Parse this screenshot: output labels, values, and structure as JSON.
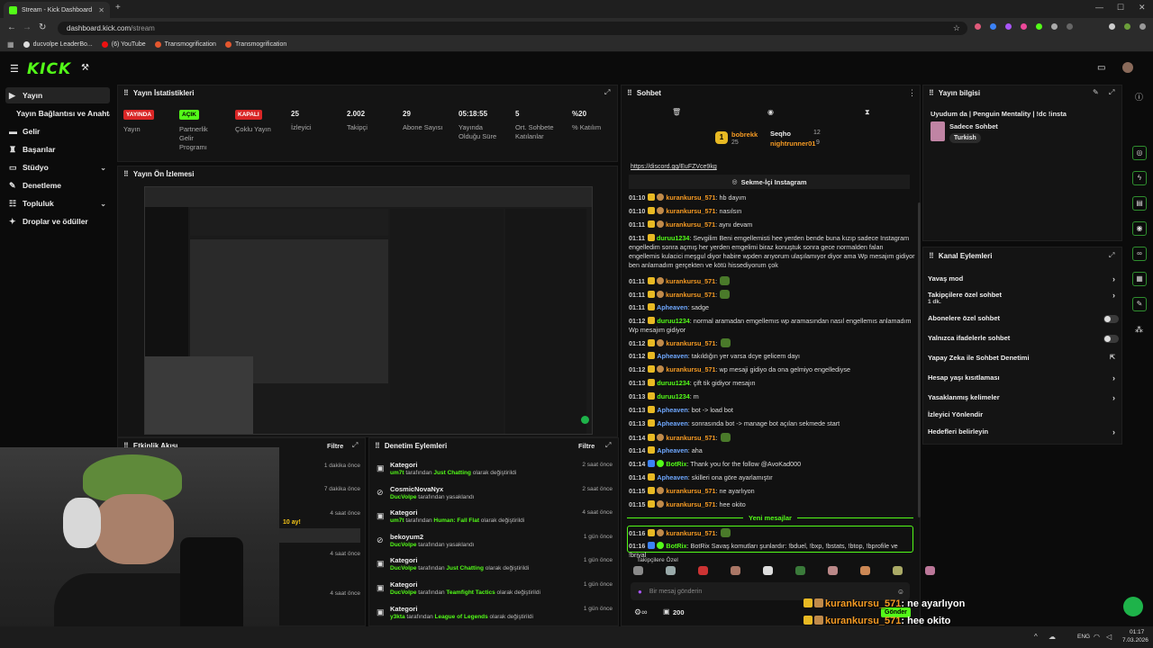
{
  "browser": {
    "tab_title": "Stream - Kick Dashboard",
    "url_host": "dashboard.kick.com",
    "url_path": "/stream",
    "bookmarks": [
      "ducvolpe LeaderBo...",
      "(6) YouTube",
      "Transmogrification",
      "Transmogrification"
    ]
  },
  "brand": {
    "logo": "KICK",
    "accent": "#53fc18"
  },
  "sidebar": {
    "items": [
      {
        "label": "Yayın",
        "icon": "video-icon"
      },
      {
        "label": "Yayın Bağlantısı ve Anahtarı",
        "icon": ""
      },
      {
        "label": "Gelir",
        "icon": "money-icon"
      },
      {
        "label": "Başarılar",
        "icon": "trophy-icon"
      },
      {
        "label": "Stüdyo",
        "icon": "studio-icon"
      },
      {
        "label": "Denetleme",
        "icon": "wrench-icon"
      },
      {
        "label": "Topluluk",
        "icon": "community-icon"
      },
      {
        "label": "Droplar ve ödüller",
        "icon": "gift-icon"
      }
    ]
  },
  "stats": {
    "title": "Yayın İstatistikleri",
    "items": [
      {
        "badge": "YAYINDA",
        "label": "Yayın"
      },
      {
        "badge": "AÇIK",
        "label": "Partnerlik Gelir Programı"
      },
      {
        "badge": "KAPALI",
        "label": "Çoklu Yayın"
      },
      {
        "value": "25",
        "label": "İzleyici"
      },
      {
        "value": "2.002",
        "label": "Takipçi"
      },
      {
        "value": "29",
        "label": "Abone Sayısı"
      },
      {
        "value": "05:18:55",
        "label": "Yayında Olduğu Süre"
      },
      {
        "value": "5",
        "label": "Ort. Sohbete Katılanlar"
      },
      {
        "value": "%20",
        "label": "% Katılım"
      }
    ]
  },
  "preview": {
    "title": "Yayın Ön İzlemesi"
  },
  "activity": {
    "title": "Etkinlik Akışı",
    "filter": "Filtre",
    "times": [
      "1 dakika önce",
      "7 dakika önce",
      "4 saat önce",
      "4 saat önce",
      "4 saat önce"
    ],
    "snippet": "10 ay!"
  },
  "mod": {
    "title": "Denetim Eylemleri",
    "filter": "Filtre",
    "rows": [
      {
        "title": "Kategori",
        "user": "um7t",
        "mid": " tarafından ",
        "target": "Just Chatting",
        "tail": " olarak değiştirildi",
        "time": "2 saat önce"
      },
      {
        "title": "CosmicNovaNyx",
        "user": "DucVolpe",
        "mid": " tarafından yasaklandı",
        "target": "",
        "tail": "",
        "time": "2 saat önce"
      },
      {
        "title": "Kategori",
        "user": "um7t",
        "mid": " tarafından ",
        "target": "Human: Fall Flat",
        "tail": " olarak değiştirildi",
        "time": "4 saat önce"
      },
      {
        "title": "bekoyum2",
        "user": "DucVolpe",
        "mid": " tarafından yasaklandı",
        "target": "",
        "tail": "",
        "time": "1 gün önce"
      },
      {
        "title": "Kategori",
        "user": "DucVolpe",
        "mid": " tarafından ",
        "target": "Just Chatting",
        "tail": " olarak değiştirildi",
        "time": "1 gün önce"
      },
      {
        "title": "Kategori",
        "user": "DucVolpe",
        "mid": " tarafından ",
        "target": "Teamfight Tactics",
        "tail": " olarak değiştirildi",
        "time": "1 gün önce"
      },
      {
        "title": "Kategori",
        "user": "y3kta",
        "mid": " tarafından ",
        "target": "League of Legends",
        "tail": " olarak değiştirildi",
        "time": "1 gün önce"
      }
    ]
  },
  "chat": {
    "title": "Sohbet",
    "leaders": [
      {
        "rank": "1",
        "name": "bobrekk",
        "count": "25"
      },
      {
        "name": "Seqho",
        "count": "12"
      },
      {
        "name": "nightrunner01",
        "count": "9"
      }
    ],
    "link": "https://discord.gg/EuFZVce9kg",
    "pinned": "Sekme-İçi Instagram",
    "messages": [
      {
        "t": "01:10",
        "u": "kurankursu_571",
        "c": "u-orange",
        "m": ": hb dayım"
      },
      {
        "t": "01:10",
        "u": "kurankursu_571",
        "c": "u-orange",
        "m": ": nasılsın"
      },
      {
        "t": "01:11",
        "u": "kurankursu_571",
        "c": "u-orange",
        "m": ": aynı devam"
      },
      {
        "t": "01:11",
        "u": "duruu1234",
        "c": "u-green",
        "m": ": Sevgilim Beni emgellemisti hee yerden bende buna kızıp sadece Instagram engelledim sonra açmış her yerden emgelimi biraz konuştuk sonra gece normalden falan engellemis kulacici meşgul diyor habire wpden arıyorum ulaşılamıyor diyor ama Wp mesajım gidiyor ben anlamadım gerçekten ve kötü hissediyorum çok"
      },
      {
        "t": "01:11",
        "u": "kurankursu_571",
        "c": "u-orange",
        "m": ":"
      },
      {
        "t": "01:11",
        "u": "kurankursu_571",
        "c": "u-orange",
        "m": ":"
      },
      {
        "t": "01:11",
        "u": "Apheaven",
        "c": "u-blue",
        "m": ": sadge"
      },
      {
        "t": "01:12",
        "u": "duruu1234",
        "c": "u-green",
        "m": ": normal aramadan emgellemıs wp aramasından nasıl engellemıs anlamadım Wp mesajım gidiyor"
      },
      {
        "t": "01:12",
        "u": "kurankursu_571",
        "c": "u-orange",
        "m": ":"
      },
      {
        "t": "01:12",
        "u": "Apheaven",
        "c": "u-blue",
        "m": ": takıldığın yer varsa dcye gelicem dayı"
      },
      {
        "t": "01:12",
        "u": "kurankursu_571",
        "c": "u-orange",
        "m": ": wp mesaji gidiyo da ona gelmiyo engellediyse"
      },
      {
        "t": "01:13",
        "u": "duruu1234",
        "c": "u-green",
        "m": ": çift tik gidiyor mesajın"
      },
      {
        "t": "01:13",
        "u": "duruu1234",
        "c": "u-green",
        "m": ": m"
      },
      {
        "t": "01:13",
        "u": "Apheaven",
        "c": "u-blue",
        "m": ": bot -> load bot"
      },
      {
        "t": "01:13",
        "u": "Apheaven",
        "c": "u-blue",
        "m": ": sonrasında bot -> manage bot açılan sekmede start"
      },
      {
        "t": "01:14",
        "u": "kurankursu_571",
        "c": "u-orange",
        "m": ":"
      },
      {
        "t": "01:14",
        "u": "Apheaven",
        "c": "u-blue",
        "m": ": aha"
      },
      {
        "t": "01:14",
        "u": "BotRix",
        "c": "u-green",
        "m": ": Thank you for the follow @AvoKad000"
      },
      {
        "t": "01:14",
        "u": "Apheaven",
        "c": "u-blue",
        "m": ": skilleri ona göre ayarlamıştır"
      },
      {
        "t": "01:15",
        "u": "kurankursu_571",
        "c": "u-orange",
        "m": ": ne ayarlıyon"
      },
      {
        "t": "01:15",
        "u": "kurankursu_571",
        "c": "u-orange",
        "m": ": hee okito"
      }
    ],
    "new_messages": "Yeni mesajlar",
    "new": [
      {
        "t": "01:16",
        "u": "kurankursu_571",
        "c": "u-orange",
        "m": ":"
      },
      {
        "t": "01:16",
        "u": "BotRix",
        "c": "u-green",
        "m": ": BotRix Savaş komutları şunlardır: !bduel, !bxp, !bstats, !btop, !bprofile ve !brival"
      }
    ],
    "followers_label": "Takipçilere Özel",
    "input_placeholder": "Bir mesaj gönderin",
    "send_label": "Gönder",
    "points": "200"
  },
  "info": {
    "title": "Yayın bilgisi",
    "stream_title": "Uyudum da | Penguin Mentality | !dc !insta",
    "category": "Sadece Sohbet",
    "tag": "Turkish"
  },
  "actions": {
    "title": "Kanal Eylemleri",
    "items": [
      {
        "label": "Yavaş mod",
        "type": "arrow"
      },
      {
        "label": "Takipçilere özel sohbet",
        "sub": "1 dk.",
        "type": "arrow"
      },
      {
        "label": "Abonelere özel sohbet",
        "type": "toggle"
      },
      {
        "label": "Yalnızca ifadelerle sohbet",
        "type": "toggle"
      },
      {
        "label": "Yapay Zeka ile Sohbet Denetimi",
        "type": "ext"
      },
      {
        "label": "Hesap yaşı kısıtlaması",
        "type": "arrow"
      },
      {
        "label": "Yasaklanmış kelimeler",
        "type": "arrow"
      },
      {
        "label": "İzleyici Yönlendir",
        "type": "none"
      },
      {
        "label": "Hedefleri belirleyin",
        "type": "arrow"
      }
    ]
  },
  "overlay": [
    {
      "u": "kurankursu_571",
      "m": ": ne ayarlıyon"
    },
    {
      "u": "kurankursu_571",
      "m": ": hee okito"
    },
    {
      "u": "kurankursu_571",
      "m": ":"
    }
  ],
  "taskbar": {
    "lang": "ENG",
    "time": "01:17",
    "date": "7.03.2026"
  }
}
